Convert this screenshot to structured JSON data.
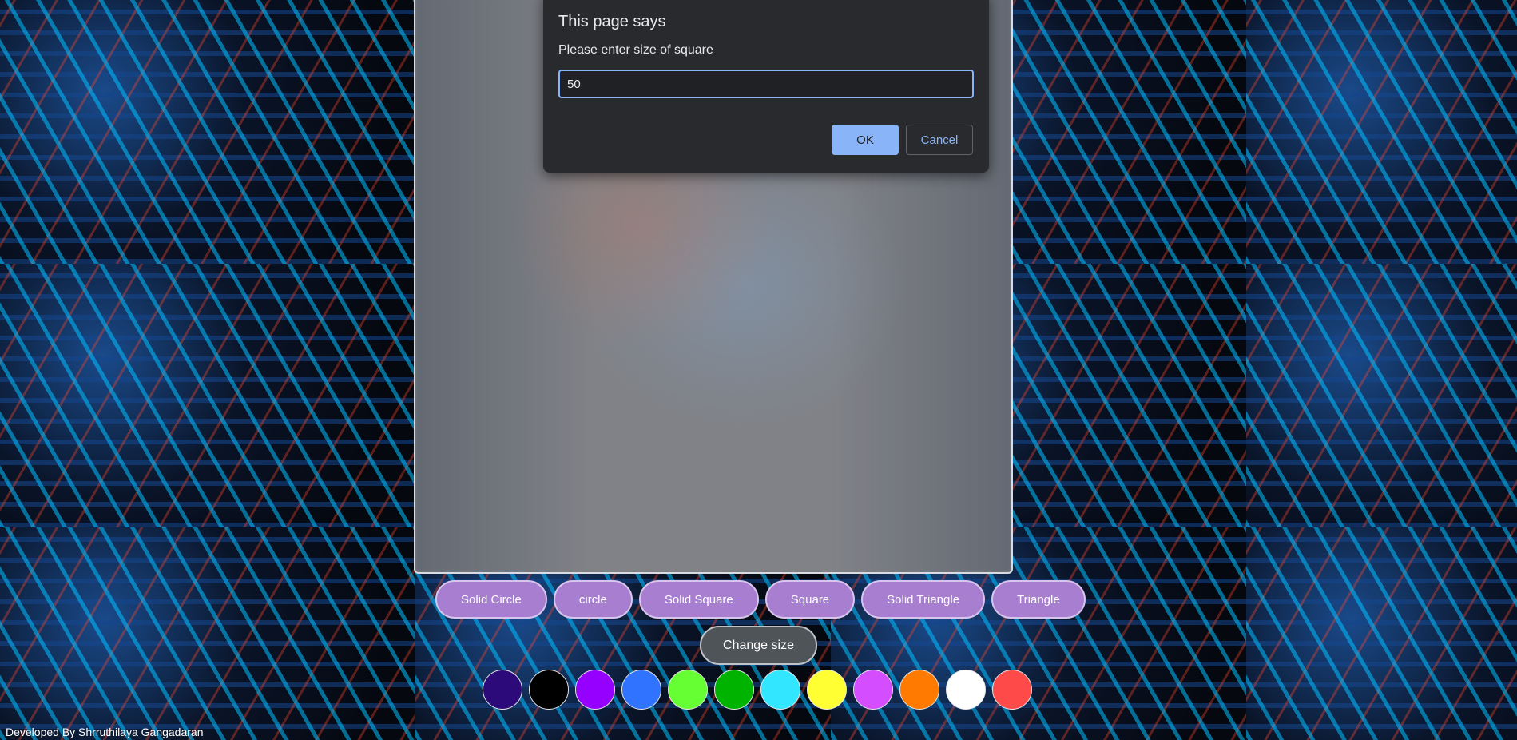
{
  "dialog": {
    "title": "This page says",
    "message": "Please enter size of square",
    "input_value": "50",
    "ok_label": "OK",
    "cancel_label": "Cancel"
  },
  "shape_buttons": [
    {
      "label": "Solid Circle"
    },
    {
      "label": "circle"
    },
    {
      "label": "Solid Square"
    },
    {
      "label": "Square"
    },
    {
      "label": "Solid Triangle"
    },
    {
      "label": "Triangle"
    }
  ],
  "change_size_label": "Change size",
  "colors": [
    {
      "name": "indigo",
      "hex": "#2d0a7a"
    },
    {
      "name": "black",
      "hex": "#000000"
    },
    {
      "name": "violet",
      "hex": "#9500ff"
    },
    {
      "name": "blue",
      "hex": "#2f73ff"
    },
    {
      "name": "lime",
      "hex": "#66ff33"
    },
    {
      "name": "green",
      "hex": "#00b300"
    },
    {
      "name": "cyan",
      "hex": "#33e6ff"
    },
    {
      "name": "yellow",
      "hex": "#ffff33"
    },
    {
      "name": "magenta",
      "hex": "#d44dff"
    },
    {
      "name": "orange",
      "hex": "#ff7a00"
    },
    {
      "name": "white",
      "hex": "#ffffff"
    },
    {
      "name": "red",
      "hex": "#ff4a4a"
    }
  ],
  "footer": {
    "credit": "Developed By Shrruthilaya Gangadaran"
  }
}
